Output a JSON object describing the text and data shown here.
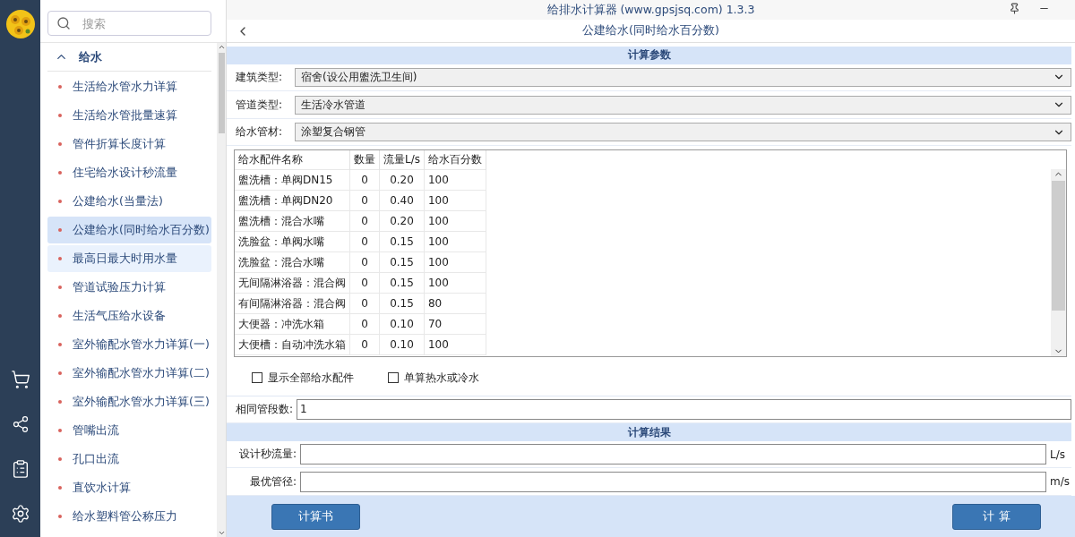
{
  "window": {
    "title": "给排水计算器 (www.gpsjsq.com) 1.3.3"
  },
  "search": {
    "placeholder": "搜索"
  },
  "nav": {
    "group": {
      "label": "给水",
      "expanded": true
    },
    "items": [
      {
        "label": "生活给水管水力详算",
        "selected": false,
        "hovered": false
      },
      {
        "label": "生活给水管批量速算",
        "selected": false,
        "hovered": false
      },
      {
        "label": "管件折算长度计算",
        "selected": false,
        "hovered": false
      },
      {
        "label": "住宅给水设计秒流量",
        "selected": false,
        "hovered": false
      },
      {
        "label": "公建给水(当量法)",
        "selected": false,
        "hovered": false
      },
      {
        "label": "公建给水(同时给水百分数)",
        "selected": true,
        "hovered": false
      },
      {
        "label": "最高日最大时用水量",
        "selected": false,
        "hovered": true
      },
      {
        "label": "管道试验压力计算",
        "selected": false,
        "hovered": false
      },
      {
        "label": "生活气压给水设备",
        "selected": false,
        "hovered": false
      },
      {
        "label": "室外输配水管水力详算(一)",
        "selected": false,
        "hovered": false
      },
      {
        "label": "室外输配水管水力详算(二)",
        "selected": false,
        "hovered": false
      },
      {
        "label": "室外输配水管水力详算(三)",
        "selected": false,
        "hovered": false
      },
      {
        "label": "管嘴出流",
        "selected": false,
        "hovered": false
      },
      {
        "label": "孔口出流",
        "selected": false,
        "hovered": false
      },
      {
        "label": "直饮水计算",
        "selected": false,
        "hovered": false
      },
      {
        "label": "给水塑料管公称压力",
        "selected": false,
        "hovered": false
      }
    ]
  },
  "page": {
    "title": "公建给水(同时给水百分数)"
  },
  "params": {
    "header": "计算参数",
    "selects": [
      {
        "label": "建筑类型:",
        "value": "宿舍(设公用盥洗卫生间)"
      },
      {
        "label": "管道类型:",
        "value": "生活冷水管道"
      },
      {
        "label": "给水管材:",
        "value": "涂塑复合钢管"
      }
    ],
    "table": {
      "columns": [
        "给水配件名称",
        "数量",
        "流量L/s",
        "给水百分数"
      ],
      "rows": [
        [
          "盥洗槽：单阀DN15",
          "0",
          "0.20",
          "100"
        ],
        [
          "盥洗槽：单阀DN20",
          "0",
          "0.40",
          "100"
        ],
        [
          "盥洗槽：混合水嘴",
          "0",
          "0.20",
          "100"
        ],
        [
          "洗脸盆：单阀水嘴",
          "0",
          "0.15",
          "100"
        ],
        [
          "洗脸盆：混合水嘴",
          "0",
          "0.15",
          "100"
        ],
        [
          "无间隔淋浴器：混合阀",
          "0",
          "0.15",
          "100"
        ],
        [
          "有间隔淋浴器：混合阀",
          "0",
          "0.15",
          "80"
        ],
        [
          "大便器：冲洗水箱",
          "0",
          "0.10",
          "70"
        ],
        [
          "大便槽：自动冲洗水箱",
          "0",
          "0.10",
          "100"
        ]
      ]
    },
    "options": [
      {
        "label": "显示全部给水配件",
        "checked": false
      },
      {
        "label": "单算热水或冷水",
        "checked": false
      }
    ],
    "segments": {
      "label": "相同管段数:",
      "value": "1"
    }
  },
  "results": {
    "header": "计算结果",
    "fields": [
      {
        "label": "设计秒流量:",
        "unit": "L/s"
      },
      {
        "label": "最优管径:",
        "unit": "m/s"
      }
    ]
  },
  "buttons": [
    {
      "label": "计算书"
    },
    {
      "label": "计 算"
    }
  ]
}
